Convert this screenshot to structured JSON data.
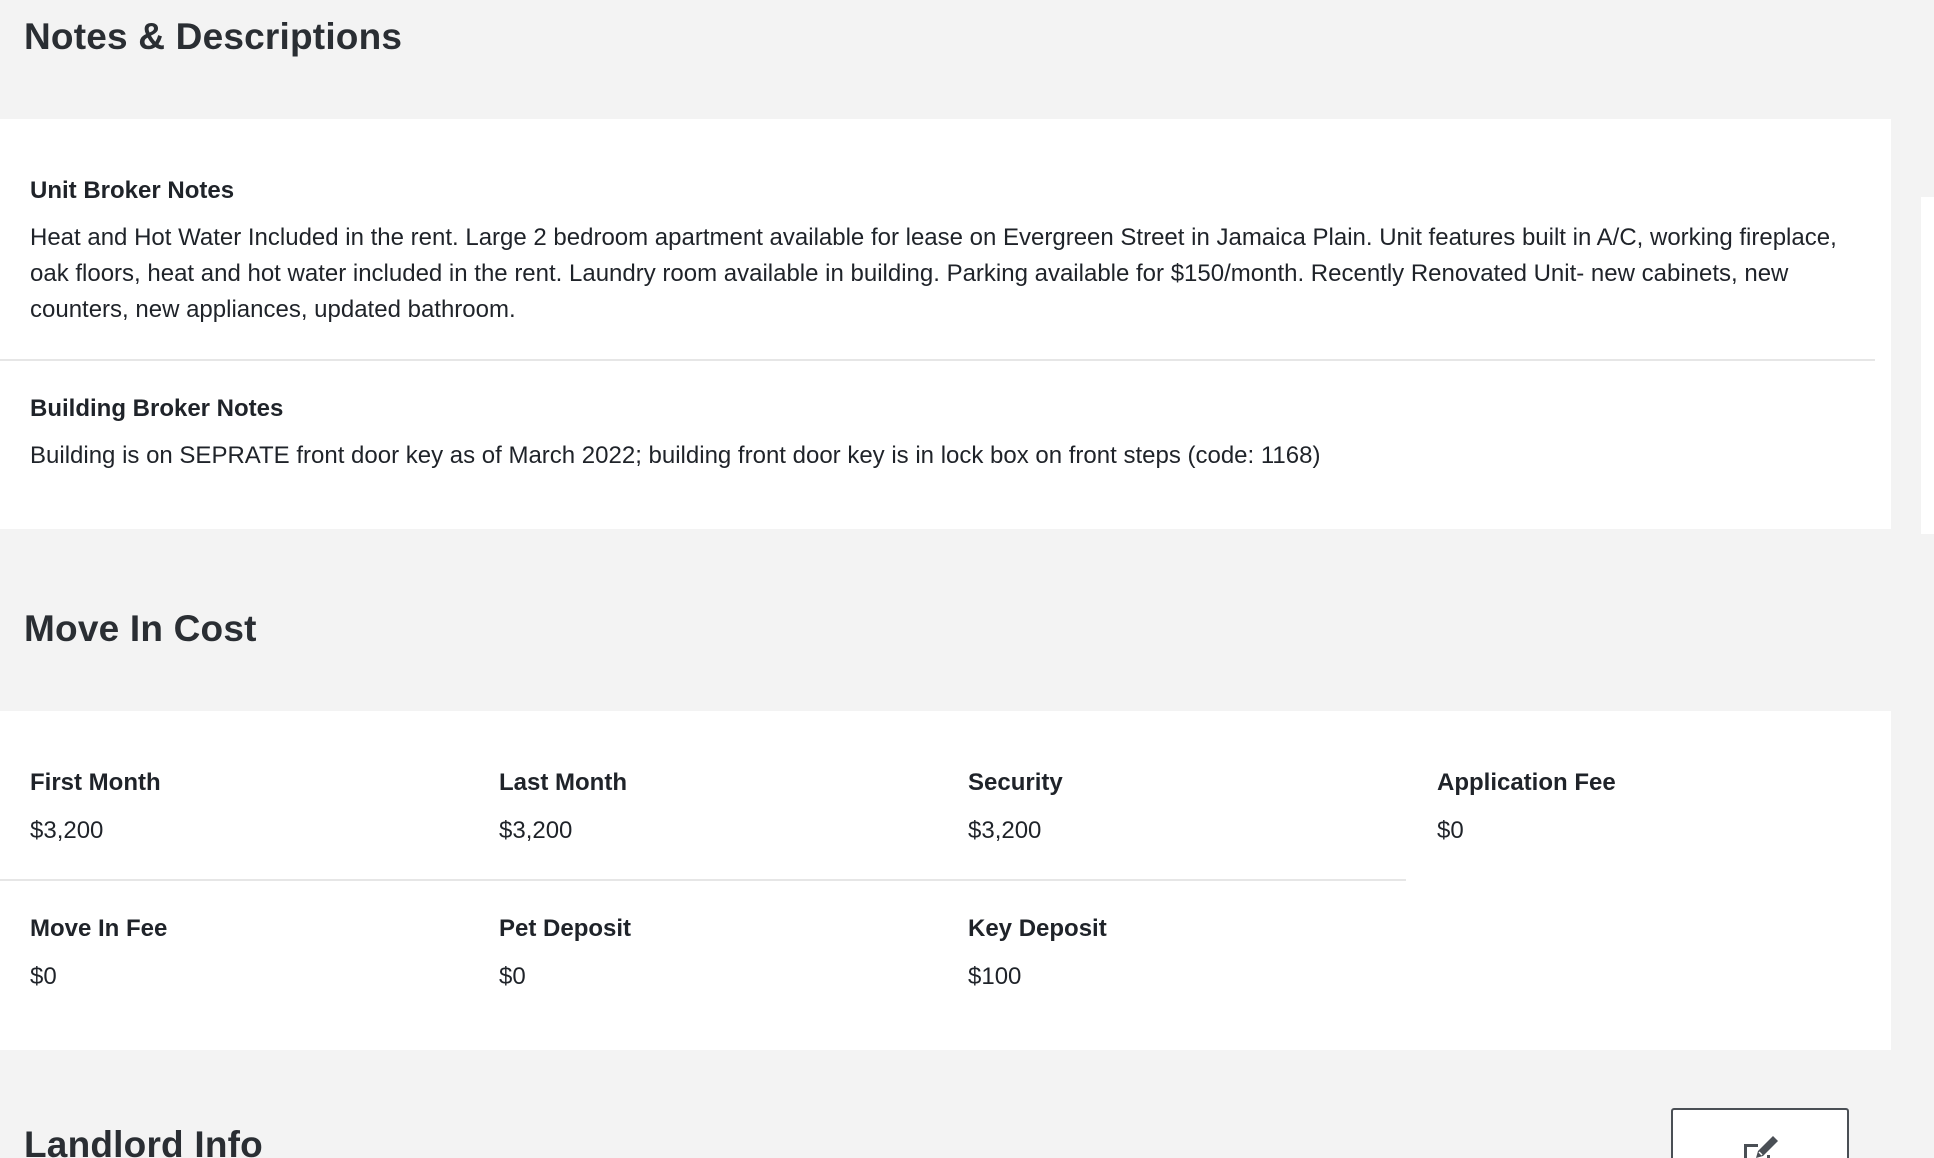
{
  "notes_section": {
    "title": "Notes & Descriptions",
    "unit_broker_notes": {
      "label": "Unit Broker Notes",
      "text": "Heat and Hot Water Included in the rent. Large 2 bedroom apartment available for lease on Evergreen Street in Jamaica Plain. Unit features built in A/C, working fireplace, oak floors, heat and hot water included in the rent. Laundry room available in building. Parking available for $150/month. Recently Renovated Unit- new cabinets, new counters, new appliances, updated bathroom."
    },
    "building_broker_notes": {
      "label": "Building Broker Notes",
      "text": "Building is on SEPRATE front door key as of March 2022; building front door key is in lock box on front steps (code: 1168)"
    }
  },
  "move_in_cost": {
    "title": "Move In Cost",
    "items": [
      {
        "label": "First Month",
        "value": "$3,200"
      },
      {
        "label": "Last Month",
        "value": "$3,200"
      },
      {
        "label": "Security",
        "value": "$3,200"
      },
      {
        "label": "Application Fee",
        "value": "$0"
      },
      {
        "label": "Move In Fee",
        "value": "$0"
      },
      {
        "label": "Pet Deposit",
        "value": "$0"
      },
      {
        "label": "Key Deposit",
        "value": "$100"
      }
    ]
  },
  "landlord_section": {
    "title": "Landlord Info",
    "edit_icon": "edit-icon"
  },
  "colors": {
    "page_background": "#f3f3f3",
    "card_background": "#ffffff",
    "text": "#1f2329",
    "divider": "#e6e6e6"
  }
}
